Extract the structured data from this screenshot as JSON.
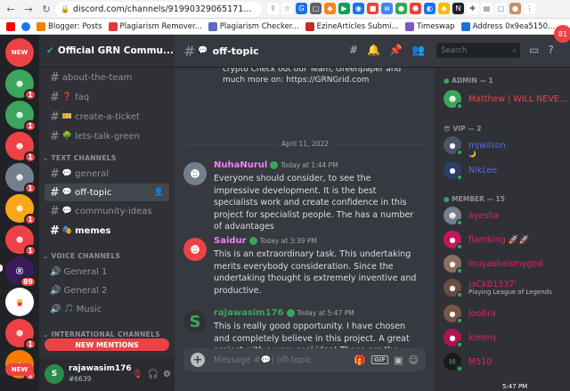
{
  "browser": {
    "url": "discord.com/channels/91990329065171...",
    "bookmarks": [
      "Blogger: Posts",
      "Plagiarism Remover...",
      "Plagiarism Checker...",
      "EzineArticles Submi...",
      "Timeswap",
      "Address 0x9ea5150..."
    ],
    "tab_counter": "81"
  },
  "rail": {
    "new_label": "NEW",
    "badges": [
      "1",
      "1",
      "1",
      "1",
      "1",
      "1",
      "1",
      "89",
      "1",
      "1",
      "1"
    ],
    "new_bottom": "NEW"
  },
  "server": {
    "name": "Official GRN Commu...",
    "channels_top": [
      {
        "emoji": "",
        "name": "about-the-team"
      },
      {
        "emoji": "❓",
        "name": "faq"
      },
      {
        "emoji": "🎫",
        "name": "create-a-ticket"
      },
      {
        "emoji": "🌳",
        "name": "lets-talk-green"
      }
    ],
    "cat_text": "TEXT CHANNELS",
    "text_channels": [
      {
        "emoji": "💬",
        "name": "general"
      },
      {
        "emoji": "💬",
        "name": "off-topic"
      },
      {
        "emoji": "💬",
        "name": "community-ideas"
      },
      {
        "emoji": "🎭",
        "name": "memes"
      }
    ],
    "cat_voice": "VOICE CHANNELS",
    "voice_channels": [
      {
        "name": "General 1"
      },
      {
        "name": "General 2"
      },
      {
        "name": "Music"
      }
    ],
    "cat_intl": "INTERNATIONAL CHANNELS",
    "new_mentions": "NEW MENTIONS"
  },
  "user": {
    "name": "rajawasim176",
    "tag": "#6639"
  },
  "chat": {
    "channel": "off-topic",
    "search_placeholder": "Search",
    "prev_text": "crypto Check out our Team, Greenpaper and much more on: https://GRNGrid.com",
    "date_divider": "April 11, 2022",
    "messages": [
      {
        "author": "NuhaNurul",
        "time": "Today at 1:44 PM",
        "color": "#f47fff",
        "text": "Everyone should consider, to see the impressive development. It is the best specialists work and create confidence in this project for specialist people. The has a number of advantages"
      },
      {
        "author": "Saidur",
        "time": "Today at 3:39 PM",
        "color": "#f47fff",
        "text": "This is an extraordinary task. This undertaking merits everybody consideration. Since the undertaking thought is extremely inventive and productive."
      },
      {
        "author": "rajawasim176",
        "time": "Today at 5:47 PM",
        "color": "#3ba55d",
        "text": "This is really good opportunity. I have chosen and completely believe in this project. A great project with a very cool idea! These are the projects I always suggest."
      }
    ],
    "composer_placeholder": "Message #💬| off-topic",
    "gif": "GIF"
  },
  "members": {
    "admin_cat": "ADMIN — 1",
    "vip_cat": "VIP — 2",
    "member_cat": "MEMBER — 15",
    "admin": [
      {
        "name": "Matthew | WILL NEVE...",
        "color": "#ed4245"
      }
    ],
    "vip": [
      {
        "name": "mjwilson",
        "color": "#5865f2",
        "sub": "🌙"
      },
      {
        "name": "NikLee",
        "color": "#5865f2",
        "sub": ""
      }
    ],
    "list": [
      {
        "name": "ayesha",
        "color": "#e91e63",
        "sub": ""
      },
      {
        "name": "flambing 🚀🚀",
        "color": "#e91e63",
        "sub": ""
      },
      {
        "name": "inuyashaismygod",
        "color": "#e91e63",
        "sub": ""
      },
      {
        "name": "jaCkB1337'",
        "color": "#e91e63",
        "sub": "Playing League of Legends"
      },
      {
        "name": "JooBra",
        "color": "#e91e63",
        "sub": ""
      },
      {
        "name": "kimmy",
        "color": "#e91e63",
        "sub": ""
      },
      {
        "name": "M510",
        "color": "#e91e63",
        "sub": ""
      }
    ]
  },
  "taskbar_time": "5:47 PM"
}
